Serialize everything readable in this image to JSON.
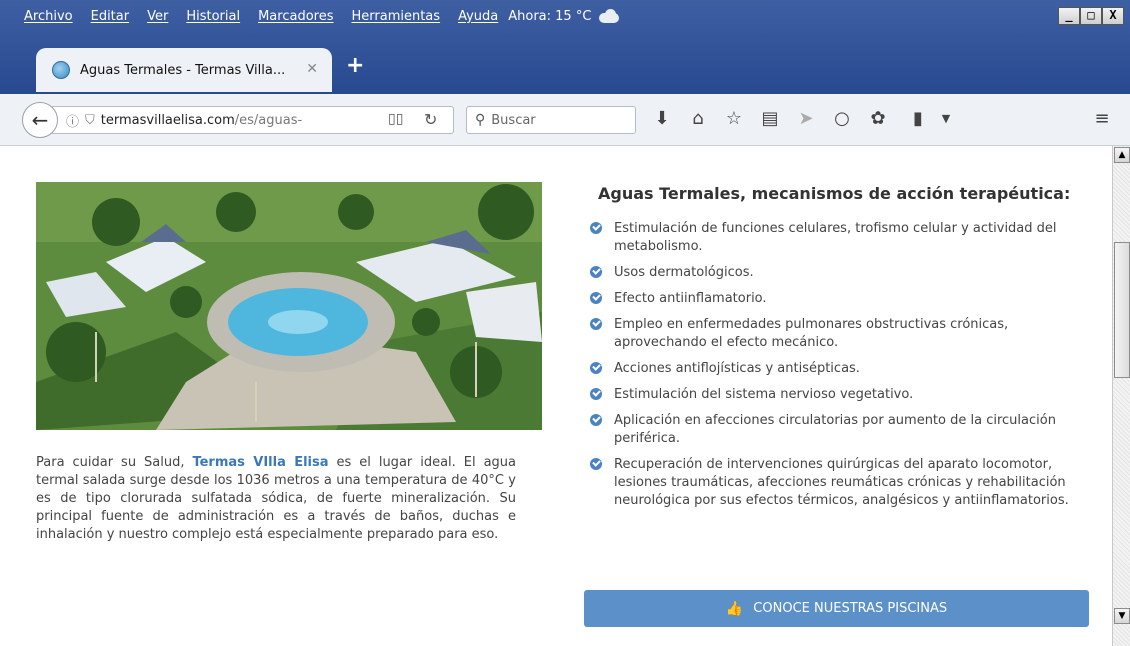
{
  "menu": [
    "Archivo",
    "Editar",
    "Ver",
    "Historial",
    "Marcadores",
    "Herramientas",
    "Ayuda"
  ],
  "weather": {
    "label": "Ahora: 15 °C",
    "icon": "cloud-icon"
  },
  "window_controls": {
    "minimize": "_",
    "maximize": "□",
    "close": "X"
  },
  "tab": {
    "title": "Aguas Termales - Termas Villa...",
    "close": "✕",
    "new_tab": "+"
  },
  "navbar": {
    "url_domain": "termasvillaelisa.com",
    "url_path": "/es/aguas-",
    "search_placeholder": "Buscar"
  },
  "content": {
    "intro": {
      "before": "Para cuidar su Salud, ",
      "brand": "Termas VIlla Elisa",
      "after": " es el lugar ideal. El agua termal salada surge desde los 1036 metros a una temperatura de 40°C y es de tipo clorurada sulfatada sódica, de fuerte mineralización. Su principal fuente de administración es a través de baños, duchas e inhalación y nuestro complejo está especialmente preparado para eso."
    },
    "heading": "Aguas Termales, mecanismos de acción terapéutica:",
    "benefits": [
      "Estimulación de funciones celulares, trofismo celular y actividad del metabolismo.",
      "Usos dermatológicos.",
      "Efecto antiinflamatorio.",
      "Empleo en enfermedades pulmonares obstructivas crónicas, aprovechando el efecto mecánico.",
      "Acciones antiflojísticas y antisépticas.",
      "Estimulación del sistema nervioso vegetativo.",
      "Aplicación en afecciones circulatorias por aumento de la circulación periférica.",
      "Recuperación de intervenciones quirúrgicas del aparato locomotor, lesiones traumáticas, afecciones reumáticas crónicas y rehabilitación neurológica por sus efectos térmicos, analgésicos y antiinflamatorios."
    ],
    "cta_label": "CONOCE NUESTRAS PISCINAS"
  },
  "colors": {
    "accent": "#5c90c9",
    "brand_link": "#3b78b8",
    "titlebar": "#27498f"
  }
}
